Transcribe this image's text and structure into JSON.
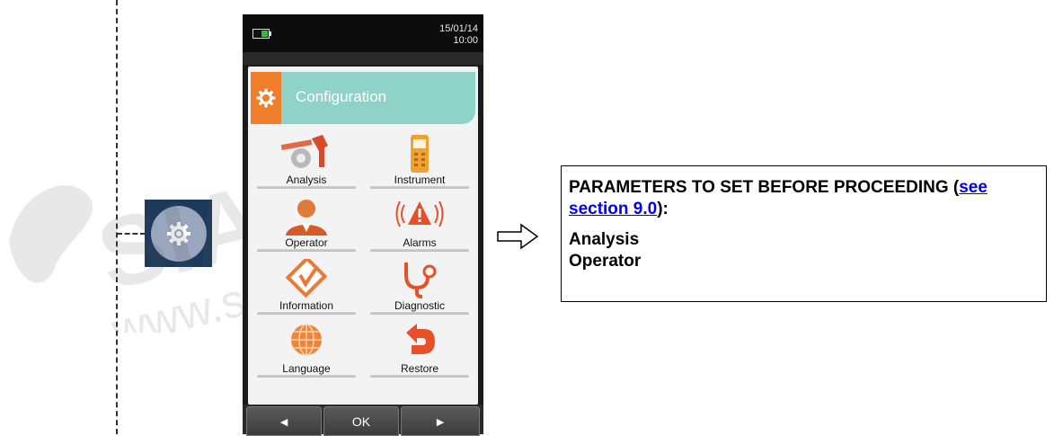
{
  "watermark": {
    "brand": "SIAFA",
    "site": "www.siafa.com.ar",
    "registered": "®"
  },
  "device": {
    "status": {
      "date": "15/01/14",
      "time": "10:00"
    },
    "header": {
      "title": "Configuration"
    },
    "menu": [
      {
        "label": "Analysis",
        "icon": "analysis-icon"
      },
      {
        "label": "Instrument",
        "icon": "instrument-icon"
      },
      {
        "label": "Operator",
        "icon": "operator-icon"
      },
      {
        "label": "Alarms",
        "icon": "alarm-icon"
      },
      {
        "label": "Information",
        "icon": "information-icon"
      },
      {
        "label": "Diagnostic",
        "icon": "stethoscope-icon"
      },
      {
        "label": "Language",
        "icon": "globe-icon"
      },
      {
        "label": "Restore",
        "icon": "restore-icon"
      }
    ],
    "buttons": {
      "left": "◄",
      "ok": "OK",
      "right": "►"
    }
  },
  "note": {
    "heading_pre": "PARAMETERS TO SET BEFORE PROCEEDING (",
    "link": "see section 9.0",
    "heading_post": "):",
    "items": [
      "Analysis",
      "Operator"
    ]
  },
  "colors": {
    "accent_orange": "#f07d2a",
    "header_teal": "#8fd3c8",
    "tile_navy": "#1d3a5c"
  }
}
